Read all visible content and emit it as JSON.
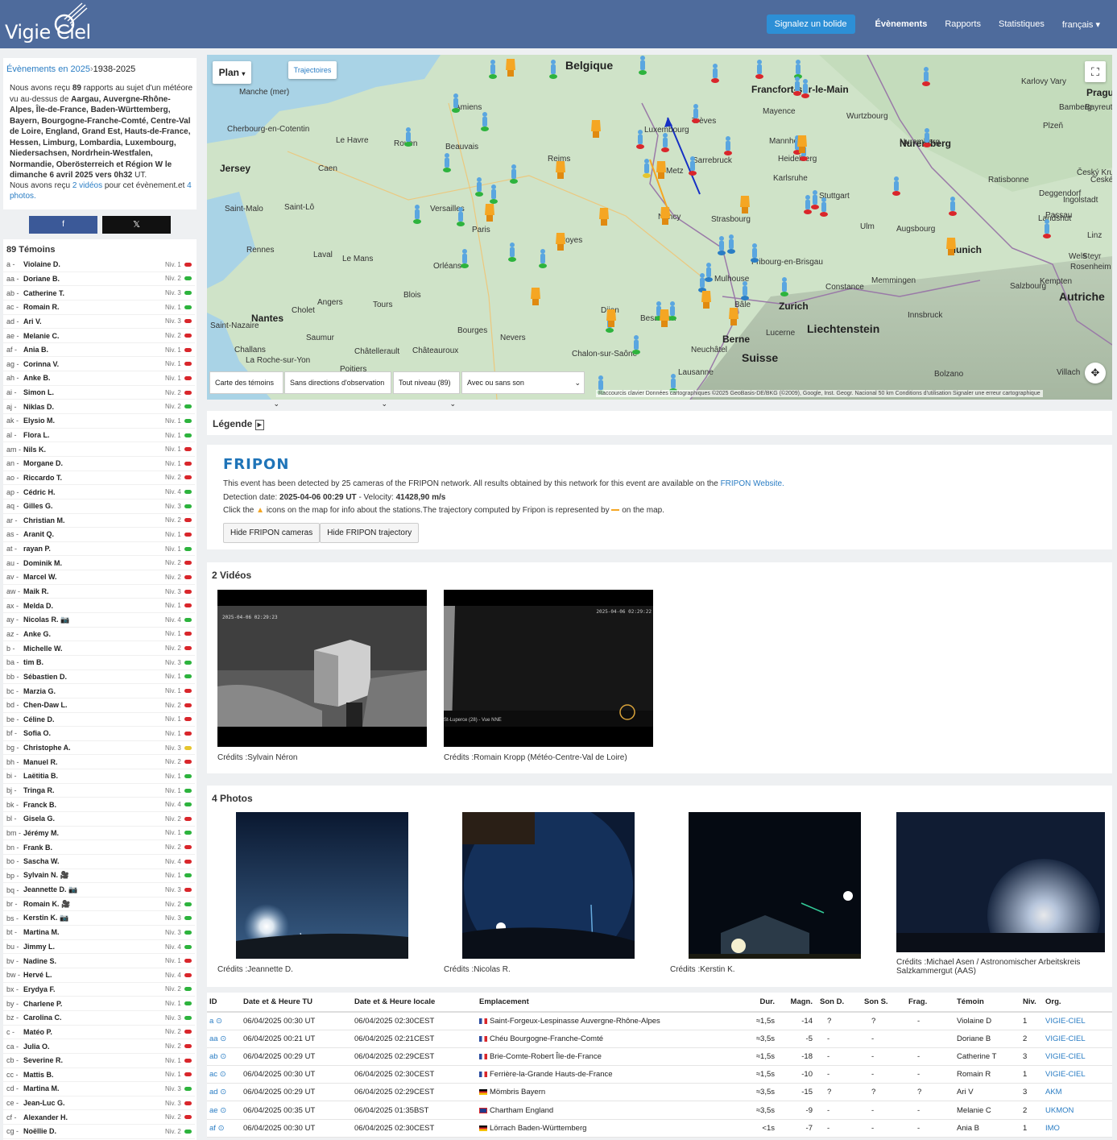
{
  "nav": {
    "brand": "Vigie Ciel",
    "report_button": "Signalez un bolide",
    "links": [
      "Évènements",
      "Rapports",
      "Statistiques",
      "français"
    ]
  },
  "event": {
    "title_prefix": "Évènements en 2025",
    "title_range": "1938-2025",
    "description_intro": "Nous avons reçu",
    "report_count": "89",
    "description_mid": "rapports au sujet d'un météore vu au-dessus de",
    "regions": "Aargau, Auvergne-Rhône-Alpes, Île-de-France, Baden-Württemberg, Bayern, Bourgogne-Franche-Comté, Centre-Val de Loire, England, Grand Est, Hauts-de-France, Hessen, Limburg, Lombardia, Luxembourg, Niedersachsen, Nordrhein-Westfalen, Normandie, Oberösterreich et Région W",
    "date_text": "le dimanche 6 avril 2025 vers 0h32",
    "time_unit": "UT.",
    "media_intro": "Nous avons reçu",
    "videos_link": "2 vidéos",
    "media_mid": "pour cet évènement.et",
    "photos_link": "4 photos."
  },
  "share": {
    "facebook": "f",
    "x": "𝕏"
  },
  "witnesses": {
    "title": "89 Témoins",
    "items": [
      {
        "id": "a -",
        "name": "Violaine D.",
        "niv": "Niv. 1",
        "color": "#d9262b"
      },
      {
        "id": "aa -",
        "name": "Doriane B.",
        "niv": "Niv. 2",
        "color": "#2db33d"
      },
      {
        "id": "ab -",
        "name": "Catherine T.",
        "niv": "Niv. 3",
        "color": "#2db33d"
      },
      {
        "id": "ac -",
        "name": "Romain R.",
        "niv": "Niv. 1",
        "color": "#2db33d"
      },
      {
        "id": "ad -",
        "name": "Ari V.",
        "niv": "Niv. 3",
        "color": "#d9262b"
      },
      {
        "id": "ae -",
        "name": "Melanie C.",
        "niv": "Niv. 2",
        "color": "#d9262b"
      },
      {
        "id": "af -",
        "name": "Ania B.",
        "niv": "Niv. 1",
        "color": "#d9262b"
      },
      {
        "id": "ag -",
        "name": "Corinna V.",
        "niv": "Niv. 1",
        "color": "#d9262b"
      },
      {
        "id": "ah -",
        "name": "Anke B.",
        "niv": "Niv. 1",
        "color": "#d9262b"
      },
      {
        "id": "ai -",
        "name": "Simon L.",
        "niv": "Niv. 2",
        "color": "#d9262b"
      },
      {
        "id": "aj -",
        "name": "Niklas D.",
        "niv": "Niv. 2",
        "color": "#2db33d"
      },
      {
        "id": "ak -",
        "name": "Elysio M.",
        "niv": "Niv. 1",
        "color": "#2db33d"
      },
      {
        "id": "al -",
        "name": "Flora L.",
        "niv": "Niv. 1",
        "color": "#2db33d"
      },
      {
        "id": "am -",
        "name": "Nils K.",
        "niv": "Niv. 1",
        "color": "#d9262b"
      },
      {
        "id": "an -",
        "name": "Morgane D.",
        "niv": "Niv. 1",
        "color": "#d9262b"
      },
      {
        "id": "ao -",
        "name": "Riccardo T.",
        "niv": "Niv. 2",
        "color": "#d9262b"
      },
      {
        "id": "ap -",
        "name": "Cédric H.",
        "niv": "Niv. 4",
        "color": "#2db33d"
      },
      {
        "id": "aq -",
        "name": "Gilles G.",
        "niv": "Niv. 3",
        "color": "#2db33d"
      },
      {
        "id": "ar -",
        "name": "Christian M.",
        "niv": "Niv. 2",
        "color": "#d9262b"
      },
      {
        "id": "as -",
        "name": "Aranit Q.",
        "niv": "Niv. 1",
        "color": "#d9262b"
      },
      {
        "id": "at -",
        "name": "rayan P.",
        "niv": "Niv. 1",
        "color": "#2db33d"
      },
      {
        "id": "au -",
        "name": "Dominik M.",
        "niv": "Niv. 2",
        "color": "#d9262b"
      },
      {
        "id": "av -",
        "name": "Marcel W.",
        "niv": "Niv. 2",
        "color": "#d9262b"
      },
      {
        "id": "aw -",
        "name": "Maik R.",
        "niv": "Niv. 3",
        "color": "#d9262b"
      },
      {
        "id": "ax -",
        "name": "Melda D.",
        "niv": "Niv. 1",
        "color": "#d9262b"
      },
      {
        "id": "ay -",
        "name": "Nicolas R. 📷",
        "niv": "Niv. 4",
        "color": "#2db33d"
      },
      {
        "id": "az -",
        "name": "Anke G.",
        "niv": "Niv. 1",
        "color": "#d9262b"
      },
      {
        "id": "b -",
        "name": "Michelle W.",
        "niv": "Niv. 2",
        "color": "#d9262b"
      },
      {
        "id": "ba -",
        "name": "tim B.",
        "niv": "Niv. 3",
        "color": "#2db33d"
      },
      {
        "id": "bb -",
        "name": "Sébastien D.",
        "niv": "Niv. 1",
        "color": "#2db33d"
      },
      {
        "id": "bc -",
        "name": "Marzia G.",
        "niv": "Niv. 1",
        "color": "#d9262b"
      },
      {
        "id": "bd -",
        "name": "Chen-Daw L.",
        "niv": "Niv. 2",
        "color": "#d9262b"
      },
      {
        "id": "be -",
        "name": "Céline D.",
        "niv": "Niv. 1",
        "color": "#d9262b"
      },
      {
        "id": "bf -",
        "name": "Sofia O.",
        "niv": "Niv. 1",
        "color": "#d9262b"
      },
      {
        "id": "bg -",
        "name": "Christophe A.",
        "niv": "Niv. 3",
        "color": "#e6c52e"
      },
      {
        "id": "bh -",
        "name": "Manuel R.",
        "niv": "Niv. 2",
        "color": "#d9262b"
      },
      {
        "id": "bi -",
        "name": "Laëtitia B.",
        "niv": "Niv. 1",
        "color": "#2db33d"
      },
      {
        "id": "bj -",
        "name": "Tringa R.",
        "niv": "Niv. 1",
        "color": "#2db33d"
      },
      {
        "id": "bk -",
        "name": "Franck B.",
        "niv": "Niv. 4",
        "color": "#2db33d"
      },
      {
        "id": "bl -",
        "name": "Gisela G.",
        "niv": "Niv. 2",
        "color": "#d9262b"
      },
      {
        "id": "bm -",
        "name": "Jérémy M.",
        "niv": "Niv. 1",
        "color": "#2db33d"
      },
      {
        "id": "bn -",
        "name": "Frank B.",
        "niv": "Niv. 2",
        "color": "#d9262b"
      },
      {
        "id": "bo -",
        "name": "Sascha W.",
        "niv": "Niv. 4",
        "color": "#d9262b"
      },
      {
        "id": "bp -",
        "name": "Sylvain N. 🎥",
        "niv": "Niv. 1",
        "color": "#2db33d"
      },
      {
        "id": "bq -",
        "name": "Jeannette D. 📷",
        "niv": "Niv. 3",
        "color": "#d9262b"
      },
      {
        "id": "br -",
        "name": "Romain K. 🎥",
        "niv": "Niv. 2",
        "color": "#2db33d"
      },
      {
        "id": "bs -",
        "name": "Kerstin K. 📷",
        "niv": "Niv. 3",
        "color": "#2db33d"
      },
      {
        "id": "bt -",
        "name": "Martina M.",
        "niv": "Niv. 3",
        "color": "#2db33d"
      },
      {
        "id": "bu -",
        "name": "Jimmy L.",
        "niv": "Niv. 4",
        "color": "#2db33d"
      },
      {
        "id": "bv -",
        "name": "Nadine S.",
        "niv": "Niv. 1",
        "color": "#d9262b"
      },
      {
        "id": "bw -",
        "name": "Hervé L.",
        "niv": "Niv. 4",
        "color": "#d9262b"
      },
      {
        "id": "bx -",
        "name": "Erydya F.",
        "niv": "Niv. 2",
        "color": "#2db33d"
      },
      {
        "id": "by -",
        "name": "Charlene P.",
        "niv": "Niv. 1",
        "color": "#2db33d"
      },
      {
        "id": "bz -",
        "name": "Carolina C.",
        "niv": "Niv. 3",
        "color": "#2db33d"
      },
      {
        "id": "c -",
        "name": "Matéo P.",
        "niv": "Niv. 2",
        "color": "#d9262b"
      },
      {
        "id": "ca -",
        "name": "Julia O.",
        "niv": "Niv. 2",
        "color": "#d9262b"
      },
      {
        "id": "cb -",
        "name": "Severine R.",
        "niv": "Niv. 1",
        "color": "#d9262b"
      },
      {
        "id": "cc -",
        "name": "Mattis B.",
        "niv": "Niv. 1",
        "color": "#d9262b"
      },
      {
        "id": "cd -",
        "name": "Martina M.",
        "niv": "Niv. 3",
        "color": "#2db33d"
      },
      {
        "id": "ce -",
        "name": "Jean-Luc G.",
        "niv": "Niv. 3",
        "color": "#d9262b"
      },
      {
        "id": "cf -",
        "name": "Alexander H.",
        "niv": "Niv. 2",
        "color": "#d9262b"
      },
      {
        "id": "cg -",
        "name": "Noëllie D.",
        "niv": "Niv. 2",
        "color": "#2db33d"
      }
    ]
  },
  "map": {
    "type_button": "Plan",
    "trajectories_button": "Trajectoires",
    "filters": [
      "Carte des témoins",
      "Sans directions d'observation",
      "Tout niveau (89)",
      "Avec ou sans son"
    ],
    "attribution": "Raccourcis clavier   Données cartographiques ©2025 GeoBasis-DE/BKG (©2009), Google, Inst. Geogr. Nacional   50 km   Conditions d'utilisation   Signaler une erreur cartographique",
    "labels": [
      {
        "t": "Belgique",
        "c": "b"
      },
      {
        "t": "Francfort-sur-le-Main",
        "c": "m"
      },
      {
        "t": "Prague",
        "c": "m"
      },
      {
        "t": "Jersey",
        "c": "m"
      },
      {
        "t": "Strasbourg",
        "c": ""
      },
      {
        "t": "Zurich",
        "c": "m"
      },
      {
        "t": "Liechtenstein",
        "c": "b"
      },
      {
        "t": "Suisse",
        "c": "b"
      },
      {
        "t": "Autriche",
        "c": "b"
      },
      {
        "t": "Nantes",
        "c": "m"
      },
      {
        "t": "Le Havre",
        "c": ""
      },
      {
        "t": "Amiens",
        "c": ""
      },
      {
        "t": "Reims",
        "c": ""
      },
      {
        "t": "Metz",
        "c": ""
      },
      {
        "t": "Nancy",
        "c": ""
      },
      {
        "t": "Karlsruhe",
        "c": ""
      },
      {
        "t": "Stuttgart",
        "c": ""
      },
      {
        "t": "Augsbourg",
        "c": ""
      },
      {
        "t": "Nuremberg",
        "c": "m"
      },
      {
        "t": "Munich",
        "c": "m"
      },
      {
        "t": "Orléans",
        "c": ""
      },
      {
        "t": "Tours",
        "c": ""
      },
      {
        "t": "Le Mans",
        "c": ""
      },
      {
        "t": "Rennes",
        "c": ""
      },
      {
        "t": "Dijon",
        "c": ""
      },
      {
        "t": "Besançon",
        "c": ""
      },
      {
        "t": "Bâle",
        "c": ""
      },
      {
        "t": "Berne",
        "c": "m"
      },
      {
        "t": "Lucerne",
        "c": ""
      },
      {
        "t": "Lausanne",
        "c": ""
      },
      {
        "t": "Bolzano",
        "c": ""
      },
      {
        "t": "Innsbruck",
        "c": ""
      },
      {
        "t": "Salzbourg",
        "c": ""
      },
      {
        "t": "Linz",
        "c": ""
      },
      {
        "t": "Constance",
        "c": ""
      },
      {
        "t": "Mayence",
        "c": ""
      },
      {
        "t": "Wurtzbourg",
        "c": ""
      },
      {
        "t": "Mannheim",
        "c": ""
      },
      {
        "t": "Heidelberg",
        "c": ""
      },
      {
        "t": "Ulm",
        "c": ""
      },
      {
        "t": "Ingolstadt",
        "c": ""
      },
      {
        "t": "Ratisbonne",
        "c": ""
      },
      {
        "t": "Passau",
        "c": ""
      },
      {
        "t": "Landshut",
        "c": ""
      },
      {
        "t": "Rosenheim",
        "c": ""
      },
      {
        "t": "Kempten",
        "c": ""
      },
      {
        "t": "Memmingen",
        "c": ""
      },
      {
        "t": "Bamberg",
        "c": ""
      },
      {
        "t": "Bayreuth",
        "c": ""
      },
      {
        "t": "Plzeň",
        "c": ""
      },
      {
        "t": "Karlovy Vary",
        "c": ""
      },
      {
        "t": "Deggendorf",
        "c": ""
      },
      {
        "t": "Sarrebruck",
        "c": ""
      },
      {
        "t": "Luxembourg",
        "c": ""
      },
      {
        "t": "Trèves",
        "c": ""
      },
      {
        "t": "Mulhouse",
        "c": ""
      },
      {
        "t": "Fribourg-en-Brisgau",
        "c": ""
      },
      {
        "t": "Chalon-sur-Saône",
        "c": ""
      },
      {
        "t": "Neuchâtel",
        "c": ""
      },
      {
        "t": "Bourges",
        "c": ""
      },
      {
        "t": "Nevers",
        "c": ""
      },
      {
        "t": "Troyes",
        "c": ""
      },
      {
        "t": "Versailles",
        "c": ""
      },
      {
        "t": "Paris",
        "c": ""
      },
      {
        "t": "Rouen",
        "c": ""
      },
      {
        "t": "Caen",
        "c": ""
      },
      {
        "t": "Beauvais",
        "c": ""
      },
      {
        "t": "Cherbourg-en-Cotentin",
        "c": ""
      },
      {
        "t": "Saint-Malo",
        "c": ""
      },
      {
        "t": "Saint-Lô",
        "c": ""
      },
      {
        "t": "Angers",
        "c": ""
      },
      {
        "t": "Cholet",
        "c": ""
      },
      {
        "t": "Saumur",
        "c": ""
      },
      {
        "t": "Blois",
        "c": ""
      },
      {
        "t": "Laval",
        "c": ""
      },
      {
        "t": "Saint-Nazaire",
        "c": ""
      },
      {
        "t": "Challans",
        "c": ""
      },
      {
        "t": "La Roche-sur-Yon",
        "c": ""
      },
      {
        "t": "Poitiers",
        "c": ""
      },
      {
        "t": "Châtellerault",
        "c": ""
      },
      {
        "t": "Châteauroux",
        "c": ""
      },
      {
        "t": "Manche (mer)",
        "c": ""
      },
      {
        "t": "Villach",
        "c": ""
      },
      {
        "t": "Steyr",
        "c": ""
      },
      {
        "t": "Wels",
        "c": ""
      },
      {
        "t": "Český Krumlov",
        "c": ""
      },
      {
        "t": "České Budějovice",
        "c": ""
      },
      {
        "t": "Nuremberg",
        "c": ""
      }
    ]
  },
  "legend": {
    "title": "Légende"
  },
  "fripon": {
    "logo": "FRIPON",
    "line1": "This event has been detected by 25 cameras of the FRIPON network. All results obtained by this network for this event are available on the",
    "line1_link": "FRIPON Website.",
    "detection_label": "Detection date:",
    "detection_value": "2025-04-06 00:29 UT",
    "velocity_label": "- Velocity:",
    "velocity_value": "41428,90 m/s",
    "click_text": "Click the",
    "click_text2": "icons on the map for info about the stations.The trajectory computed by Fripon is represented by",
    "click_text3": "on the map.",
    "hide_cameras": "Hide FRIPON cameras",
    "hide_trajectory": "Hide FRIPON trajectory"
  },
  "videos": {
    "title": "2 Vidéos",
    "items": [
      {
        "credit": "Crédits :Sylvain Néron",
        "stamp": "2025-04-06 02:29:23"
      },
      {
        "credit": "Crédits :Romain Kropp (Météo-Centre-Val de Loire)",
        "stamp": "2025-04-06 02:29:22",
        "caption": "St-Luperce (28) - Vue NNE"
      }
    ]
  },
  "photos": {
    "title": "4 Photos",
    "items": [
      {
        "credit": "Crédits :Jeannette D."
      },
      {
        "credit": "Crédits :Nicolas R."
      },
      {
        "credit": "Crédits :Kerstin K."
      },
      {
        "credit": "Crédits :Michael Asen / Astronomischer Arbeitskreis Salzkammergut (AAS)"
      }
    ]
  },
  "table": {
    "headers": [
      "ID",
      "Date et & Heure TU",
      "Date et & Heure locale",
      "Emplacement",
      "Dur.",
      "Magn.",
      "Son D.",
      "Son S.",
      "Frag.",
      "Témoin",
      "Niv.",
      "Org."
    ],
    "rows": [
      {
        "id": "a",
        "tu": "06/04/2025 00:30 UT",
        "loc": "06/04/2025 02:30CEST",
        "flag": "fr",
        "place": "Saint-Forgeux-Lespinasse Auvergne-Rhône-Alpes",
        "dur": "≈1,5s",
        "mag": "-14",
        "sd": "?",
        "ss": "?",
        "fr": "-",
        "w": "Violaine D",
        "n": "1",
        "org": "VIGIE-CIEL"
      },
      {
        "id": "aa",
        "tu": "06/04/2025 00:21 UT",
        "loc": "06/04/2025 02:21CEST",
        "flag": "fr",
        "place": "Chéu Bourgogne-Franche-Comté",
        "dur": "≈3,5s",
        "mag": "-5",
        "sd": "-",
        "ss": "-",
        "fr": "",
        "w": "Doriane B",
        "n": "2",
        "org": "VIGIE-CIEL"
      },
      {
        "id": "ab",
        "tu": "06/04/2025 00:29 UT",
        "loc": "06/04/2025 02:29CEST",
        "flag": "fr",
        "place": "Brie-Comte-Robert Île-de-France",
        "dur": "≈1,5s",
        "mag": "-18",
        "sd": "-",
        "ss": "-",
        "fr": "-",
        "w": "Catherine T",
        "n": "3",
        "org": "VIGIE-CIEL"
      },
      {
        "id": "ac",
        "tu": "06/04/2025 00:30 UT",
        "loc": "06/04/2025 02:30CEST",
        "flag": "fr",
        "place": "Ferrière-la-Grande Hauts-de-France",
        "dur": "≈1,5s",
        "mag": "-10",
        "sd": "-",
        "ss": "-",
        "fr": "-",
        "w": "Romain  R",
        "n": "1",
        "org": "VIGIE-CIEL"
      },
      {
        "id": "ad",
        "tu": "06/04/2025 00:29 UT",
        "loc": "06/04/2025 02:29CEST",
        "flag": "de",
        "place": "Mömbris Bayern",
        "dur": "≈3,5s",
        "mag": "-15",
        "sd": "?",
        "ss": "?",
        "fr": "?",
        "w": "Ari V",
        "n": "3",
        "org": "AKM"
      },
      {
        "id": "ae",
        "tu": "06/04/2025 00:35 UT",
        "loc": "06/04/2025 01:35BST",
        "flag": "gb",
        "place": "Chartham England",
        "dur": "≈3,5s",
        "mag": "-9",
        "sd": "-",
        "ss": "-",
        "fr": "-",
        "w": "Melanie C",
        "n": "2",
        "org": "UKMON"
      },
      {
        "id": "af",
        "tu": "06/04/2025 00:30 UT",
        "loc": "06/04/2025 02:30CEST",
        "flag": "de",
        "place": "Lörrach Baden-Württemberg",
        "dur": "<1s",
        "mag": "-7",
        "sd": "-",
        "ss": "-",
        "fr": "-",
        "w": "Ania B",
        "n": "1",
        "org": "IMO"
      }
    ]
  },
  "colors": {
    "nav": "#4e6b9c",
    "link": "#2a7dc4",
    "accent": "#2d8fd6"
  }
}
